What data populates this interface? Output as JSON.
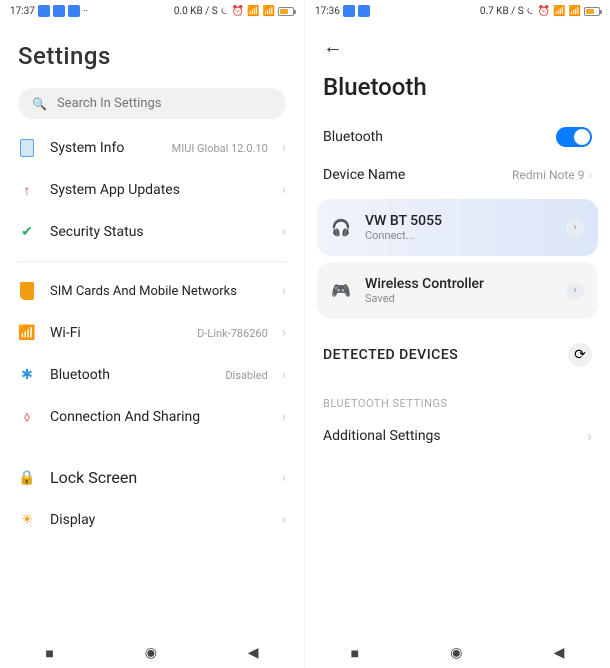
{
  "left": {
    "status": {
      "time": "17:37",
      "data": "0.0 KB / S"
    },
    "title": "Settings",
    "search_placeholder": "Search In Settings",
    "items": [
      {
        "label": "System Info",
        "value": "MIUI Global 12.0.10"
      },
      {
        "label": "System App Updates",
        "value": ""
      },
      {
        "label": "Security Status",
        "value": ""
      }
    ],
    "network_items": [
      {
        "label": "SIM Cards And Mobile Networks",
        "value": ""
      },
      {
        "label": "Wi-Fi",
        "value": "D-Link-786260"
      },
      {
        "label": "Bluetooth",
        "value": "Disabled"
      },
      {
        "label": "Connection And Sharing",
        "value": ""
      }
    ],
    "personal_items": [
      {
        "label": "Lock Screen",
        "value": ""
      },
      {
        "label": "Display",
        "value": ""
      }
    ]
  },
  "right": {
    "status": {
      "time": "17:36",
      "data": "0.7 KB / S"
    },
    "title": "Bluetooth",
    "toggle_label": "Bluetooth",
    "device_name_label": "Device Name",
    "device_name_value": "Redmi Note 9",
    "devices": [
      {
        "name": "VW BT 5055",
        "status": "Connect..."
      },
      {
        "name": "Wireless Controller",
        "status": "Saved"
      }
    ],
    "detected_label": "DETECTED DEVICES",
    "bt_settings_label": "BLUETOOTH SETTINGS",
    "additional_label": "Additional Settings"
  }
}
